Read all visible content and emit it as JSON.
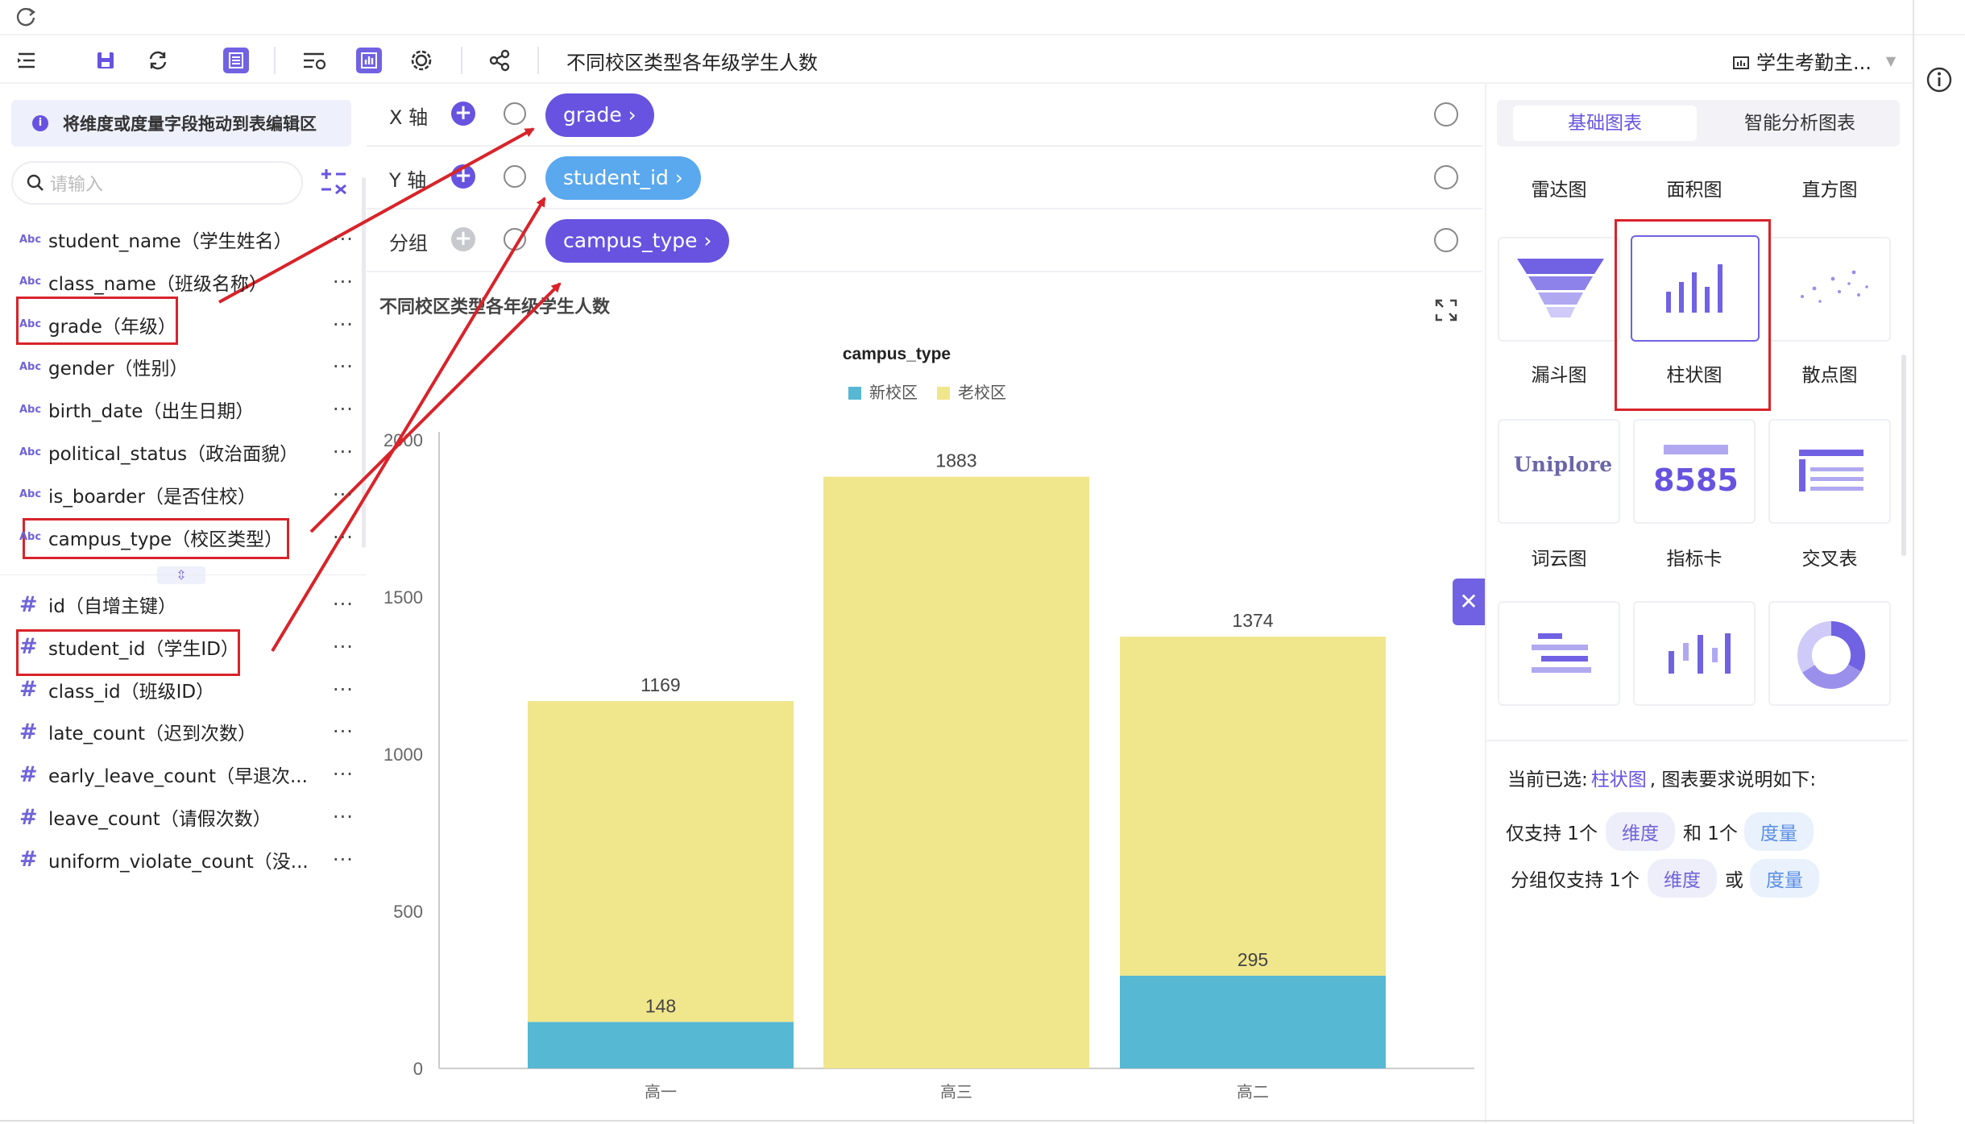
{
  "toolbar": {
    "title": "不同校区类型各年级学生人数",
    "dataset": "学生考勤主..."
  },
  "left_panel": {
    "hint": "将维度或度量字段拖动到表编辑区",
    "search_placeholder": "请输入",
    "dimensions": [
      {
        "type": "Abc",
        "label": "student_name（学生姓名）"
      },
      {
        "type": "Abc",
        "label": "class_name（班级名称）"
      },
      {
        "type": "Abc",
        "label": "grade（年级）"
      },
      {
        "type": "Abc",
        "label": "gender（性别）"
      },
      {
        "type": "Abc",
        "label": "birth_date（出生日期）"
      },
      {
        "type": "Abc",
        "label": "political_status（政治面貌）"
      },
      {
        "type": "Abc",
        "label": "is_boarder（是否住校）"
      },
      {
        "type": "Abc",
        "label": "campus_type（校区类型）"
      }
    ],
    "measures": [
      {
        "type": "#",
        "label": "id（自增主键）"
      },
      {
        "type": "#",
        "label": "student_id（学生ID）"
      },
      {
        "type": "#",
        "label": "class_id（班级ID）"
      },
      {
        "type": "#",
        "label": "late_count（迟到次数）"
      },
      {
        "type": "#",
        "label": "early_leave_count（早退次..."
      },
      {
        "type": "#",
        "label": "leave_count（请假次数）"
      },
      {
        "type": "#",
        "label": "uniform_violate_count（没..."
      }
    ],
    "more": "···"
  },
  "axes": {
    "x": {
      "label": "X 轴",
      "field": "grade ›"
    },
    "y": {
      "label": "Y 轴",
      "field": "student_id ›"
    },
    "group": {
      "label": "分组",
      "field": "campus_type ›"
    }
  },
  "chart_panel": {
    "title": "不同校区类型各年级学生人数"
  },
  "chart_data": {
    "type": "bar",
    "stacked": true,
    "legend_title": "campus_type",
    "legend_position": "top-center",
    "categories": [
      "高一",
      "高三",
      "高二"
    ],
    "series": [
      {
        "name": "新校区",
        "color": "#56b8d3",
        "values": [
          148,
          0,
          295
        ]
      },
      {
        "name": "老校区",
        "color": "#f0e68c",
        "values": [
          1021,
          1883,
          1079
        ]
      }
    ],
    "totals": [
      1169,
      1883,
      1374
    ],
    "data_labels": [
      {
        "category": "高一",
        "value": "1169"
      },
      {
        "category": "高一",
        "value": "148"
      },
      {
        "category": "高三",
        "value": "1883"
      },
      {
        "category": "高二",
        "value": "1374"
      },
      {
        "category": "高二",
        "value": "295"
      }
    ],
    "y_ticks": [
      "0",
      "500",
      "1000",
      "1500",
      "2000"
    ],
    "ylim": [
      0,
      2000
    ],
    "grid": false
  },
  "right_panel": {
    "tabs": [
      "基础图表",
      "智能分析图表"
    ],
    "chart_names_row1": [
      "雷达图",
      "面积图",
      "直方图"
    ],
    "chart_names_row2": [
      "漏斗图",
      "柱状图",
      "散点图"
    ],
    "chart_names_row3": [
      "词云图",
      "指标卡",
      "交叉表"
    ],
    "kpi_sample": "8585",
    "wordcloud_text": "Uniplore",
    "selected_prefix": "当前已选:",
    "selected_chart": "柱状图",
    "selected_suffix": ", 图表要求说明如下:",
    "req1_prefix": "仅支持 1个",
    "req1_dim": "维度",
    "req1_and": "和 1个",
    "req1_measure": "度量",
    "req2_prefix": "分组仅支持 1个",
    "req2_dim": "维度",
    "req2_or": "或",
    "req2_measure": "度量"
  },
  "colors": {
    "accent": "#6753e0",
    "annotation_red": "#d8232a",
    "series_new": "#56b8d3",
    "series_old": "#f0e68c"
  }
}
